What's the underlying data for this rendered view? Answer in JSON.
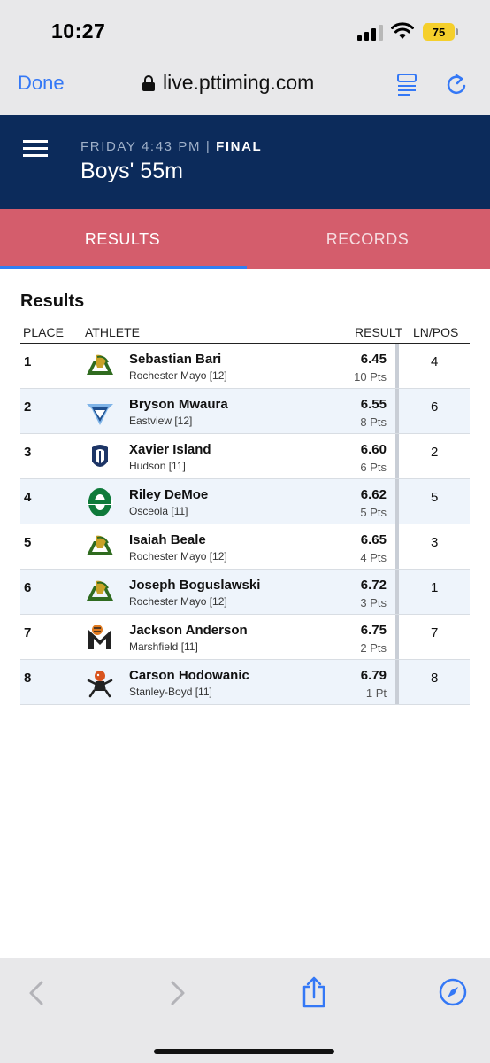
{
  "status_bar": {
    "time": "10:27",
    "battery": "75"
  },
  "browser": {
    "done_label": "Done",
    "url": "live.pttiming.com"
  },
  "header": {
    "day_time": "FRIDAY 4:43 PM",
    "separator": "|",
    "status": "FINAL",
    "event_title": "Boys' 55m"
  },
  "tabs": {
    "results": "RESULTS",
    "records": "RECORDS"
  },
  "results": {
    "section_title": "Results",
    "columns": {
      "place": "PLACE",
      "athlete": "ATHLETE",
      "result": "RESULT",
      "lane_pos": "LN/POS"
    },
    "rows": [
      {
        "place": "1",
        "name": "Sebastian Bari",
        "team": "Rochester Mayo [12]",
        "result": "6.45",
        "points": "10 Pts",
        "lane": "4",
        "logo": "rochester-mayo-logo"
      },
      {
        "place": "2",
        "name": "Bryson Mwaura",
        "team": "Eastview [12]",
        "result": "6.55",
        "points": "8 Pts",
        "lane": "6",
        "logo": "eastview-logo"
      },
      {
        "place": "3",
        "name": "Xavier Island",
        "team": "Hudson [11]",
        "result": "6.60",
        "points": "6 Pts",
        "lane": "2",
        "logo": "hudson-logo"
      },
      {
        "place": "4",
        "name": "Riley DeMoe",
        "team": "Osceola [11]",
        "result": "6.62",
        "points": "5 Pts",
        "lane": "5",
        "logo": "osceola-logo"
      },
      {
        "place": "5",
        "name": "Isaiah Beale",
        "team": "Rochester Mayo [12]",
        "result": "6.65",
        "points": "4 Pts",
        "lane": "3",
        "logo": "rochester-mayo-logo"
      },
      {
        "place": "6",
        "name": "Joseph Boguslawski",
        "team": "Rochester Mayo [12]",
        "result": "6.72",
        "points": "3 Pts",
        "lane": "1",
        "logo": "rochester-mayo-logo"
      },
      {
        "place": "7",
        "name": "Jackson Anderson",
        "team": "Marshfield [11]",
        "result": "6.75",
        "points": "2 Pts",
        "lane": "7",
        "logo": "marshfield-logo"
      },
      {
        "place": "8",
        "name": "Carson Hodowanic",
        "team": "Stanley-Boyd [11]",
        "result": "6.79",
        "points": "1 Pt",
        "lane": "8",
        "logo": "stanley-boyd-logo"
      }
    ]
  },
  "colors": {
    "header_bg": "#0c2b5b",
    "tab_bg": "#d45d6c",
    "accent": "#2f7ff5",
    "ios_blue": "#3478f6"
  }
}
